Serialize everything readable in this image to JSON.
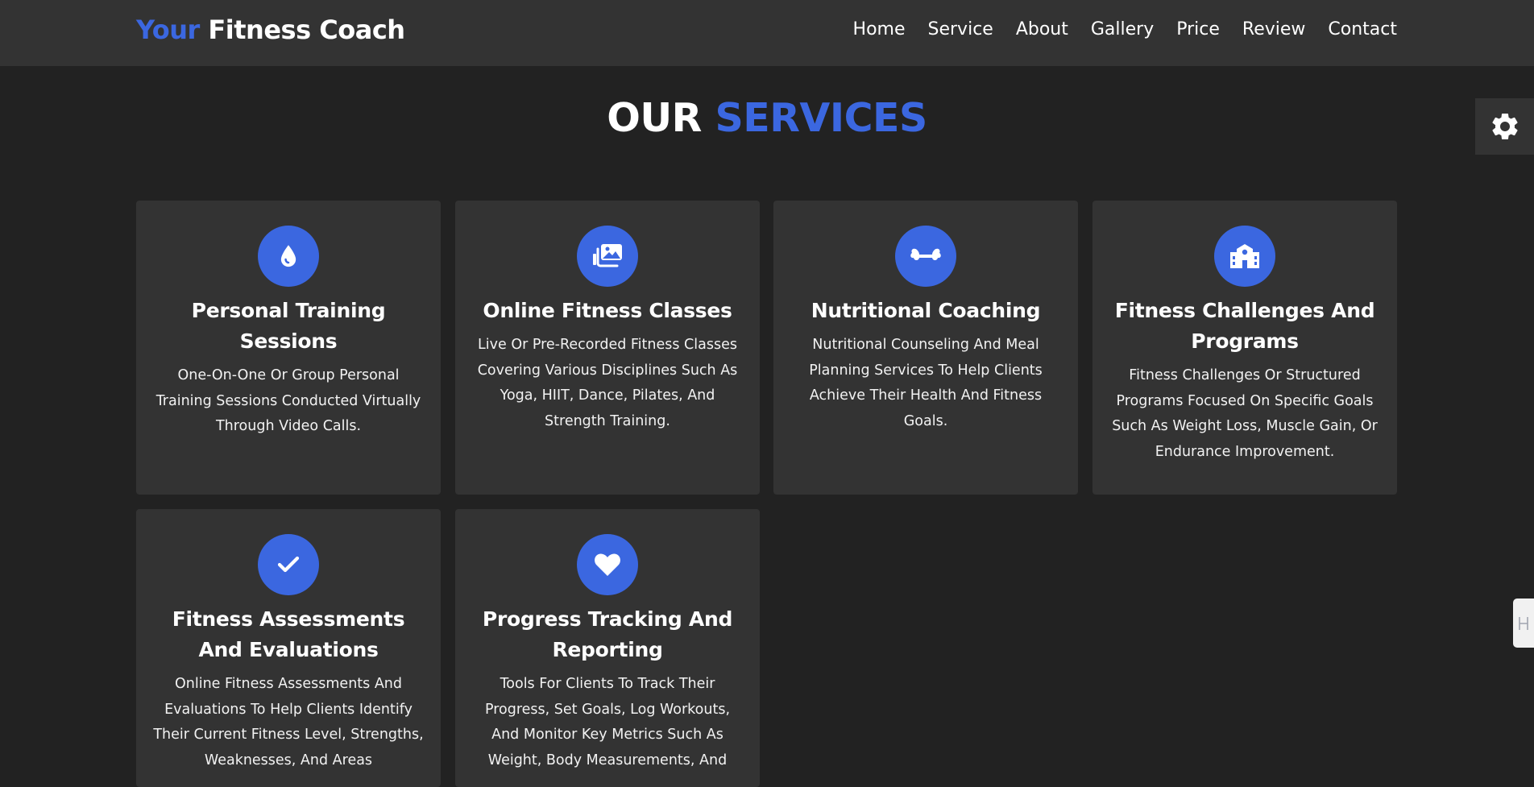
{
  "header": {
    "logo_accent": "Your",
    "logo_rest": "Fitness Coach",
    "nav": [
      "Home",
      "Service",
      "About",
      "Gallery",
      "Price",
      "Review",
      "Contact"
    ]
  },
  "section": {
    "title_main": "OUR",
    "title_accent": "SERVICES"
  },
  "colors": {
    "accent": "#3b67e0",
    "background": "#222222",
    "card": "#333333"
  },
  "services": [
    {
      "icon": "water-drop-icon",
      "title": "Personal Training Sessions",
      "description": "One-On-One Or Group Personal Training Sessions Conducted Virtually Through Video Calls."
    },
    {
      "icon": "photo-gallery-icon",
      "title": "Online Fitness Classes",
      "description": "Live Or Pre-Recorded Fitness Classes Covering Various Disciplines Such As Yoga, HIIT, Dance, Pilates, And Strength Training."
    },
    {
      "icon": "bone-icon",
      "title": "Nutritional Coaching",
      "description": "Nutritional Counseling And Meal Planning Services To Help Clients Achieve Their Health And Fitness Goals."
    },
    {
      "icon": "school-building-icon",
      "title": "Fitness Challenges And Programs",
      "description": "Fitness Challenges Or Structured Programs Focused On Specific Goals Such As Weight Loss, Muscle Gain, Or Endurance Improvement."
    },
    {
      "icon": "checkmark-icon",
      "title": "Fitness Assessments And Evaluations",
      "description": "Online Fitness Assessments And Evaluations To Help Clients Identify Their Current Fitness Level, Strengths, Weaknesses, And Areas"
    },
    {
      "icon": "heart-icon",
      "title": "Progress Tracking And Reporting",
      "description": "Tools For Clients To Track Their Progress, Set Goals, Log Workouts, And Monitor Key Metrics Such As Weight, Body Measurements, And"
    }
  ]
}
